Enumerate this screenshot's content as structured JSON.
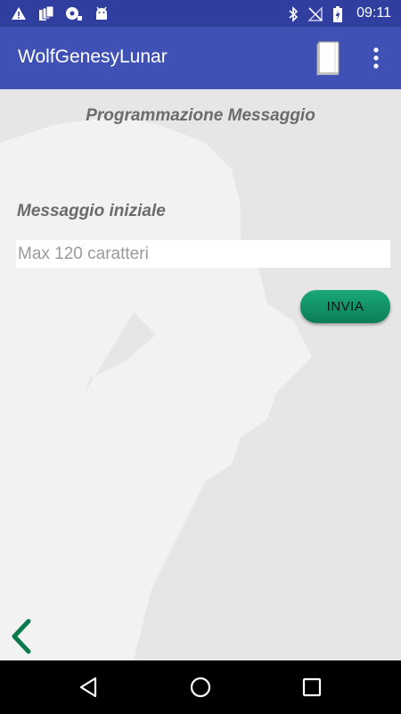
{
  "status_bar": {
    "time": "09:11",
    "icons": [
      "warning-icon",
      "copy-icon",
      "sync-icon",
      "android-icon",
      "bluetooth-icon",
      "no-signal-icon",
      "battery-icon"
    ]
  },
  "app_bar": {
    "title": "WolfGenesyLunar",
    "actions": [
      "book-icon",
      "more-vert-icon"
    ]
  },
  "main": {
    "page_title": "Programmazione Messaggio",
    "message_label": "Messaggio iniziale",
    "message_input": {
      "value": "",
      "placeholder": "Max 120 caratteri"
    },
    "send_label": "INVIA",
    "back_icon": "chevron-left-icon"
  },
  "nav_bar": {
    "icons": [
      "back-triangle-icon",
      "home-circle-icon",
      "recents-square-icon"
    ]
  },
  "colors": {
    "status_bar": "#303f9f",
    "app_bar": "#3f51b5",
    "background": "#e6e6e6",
    "send_button": "#109465",
    "back_chevron": "#0a7a4a",
    "label_text": "#6b6b6b"
  }
}
